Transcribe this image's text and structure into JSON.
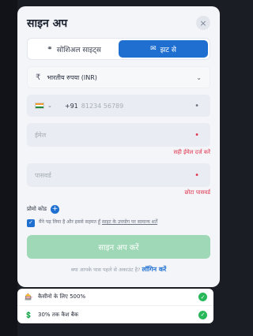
{
  "modal": {
    "title": "साइन अप",
    "close_icon": "×"
  },
  "tabs": [
    {
      "label": "सोशिअल साइट्स",
      "icon": "link-icon",
      "active": false
    },
    {
      "label": "झट से",
      "icon": "envelope-icon",
      "active": true
    }
  ],
  "currency": {
    "symbol": "₹",
    "value": "भारतीय रुपया (INR)"
  },
  "phone": {
    "prefix": "+91",
    "placeholder": "81234 56789"
  },
  "email": {
    "placeholder": "ईमेल",
    "error": "सही ईमेल दर्ज करें"
  },
  "password": {
    "placeholder": "पासवर्ड",
    "error": "छोटा पासवर्ड"
  },
  "promo_code": {
    "label": "प्रोमो कोड"
  },
  "terms": {
    "text": "मैंने पढ़ लिया है और इससे सहमत हूँ",
    "link": "साइट के उपयोग पर सामान्य शर्तें"
  },
  "submit_label": "साइन अप करें",
  "login": {
    "question": "क्या आपके पास पहले से अकाउंट है?",
    "link": "लॉगिन करें"
  },
  "offers": [
    {
      "text": "कैसीनो के लिए 500%",
      "icon": "casino-icon"
    },
    {
      "text": "30% तक कैश बैक",
      "icon": "cashback-icon"
    }
  ],
  "colors": {
    "accent": "#1f6fd1",
    "submit": "#9ed8b6",
    "error": "#e0314b",
    "success": "#28b85a"
  }
}
